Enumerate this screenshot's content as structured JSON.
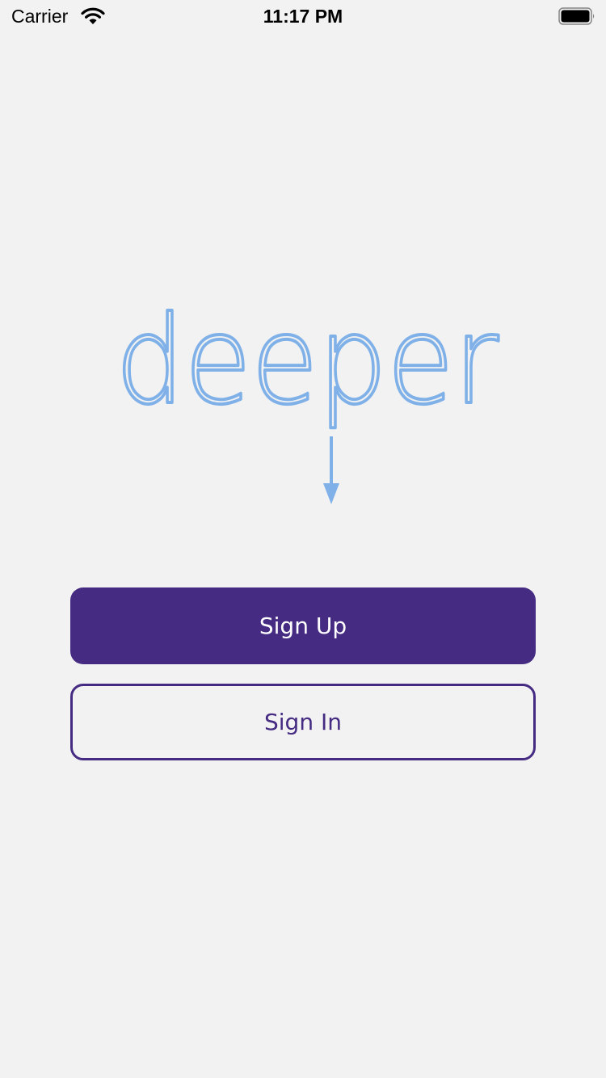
{
  "status_bar": {
    "carrier": "Carrier",
    "time": "11:17 PM",
    "wifi_icon": "wifi-icon",
    "battery_icon": "battery-icon"
  },
  "logo": {
    "text": "deeper",
    "arrow_icon": "arrow-down-icon",
    "color": "#7fb1e8"
  },
  "actions": {
    "sign_up_label": "Sign Up",
    "sign_in_label": "Sign In"
  },
  "colors": {
    "background": "#f2f2f2",
    "primary": "#452b82",
    "logo": "#7fb1e8"
  }
}
